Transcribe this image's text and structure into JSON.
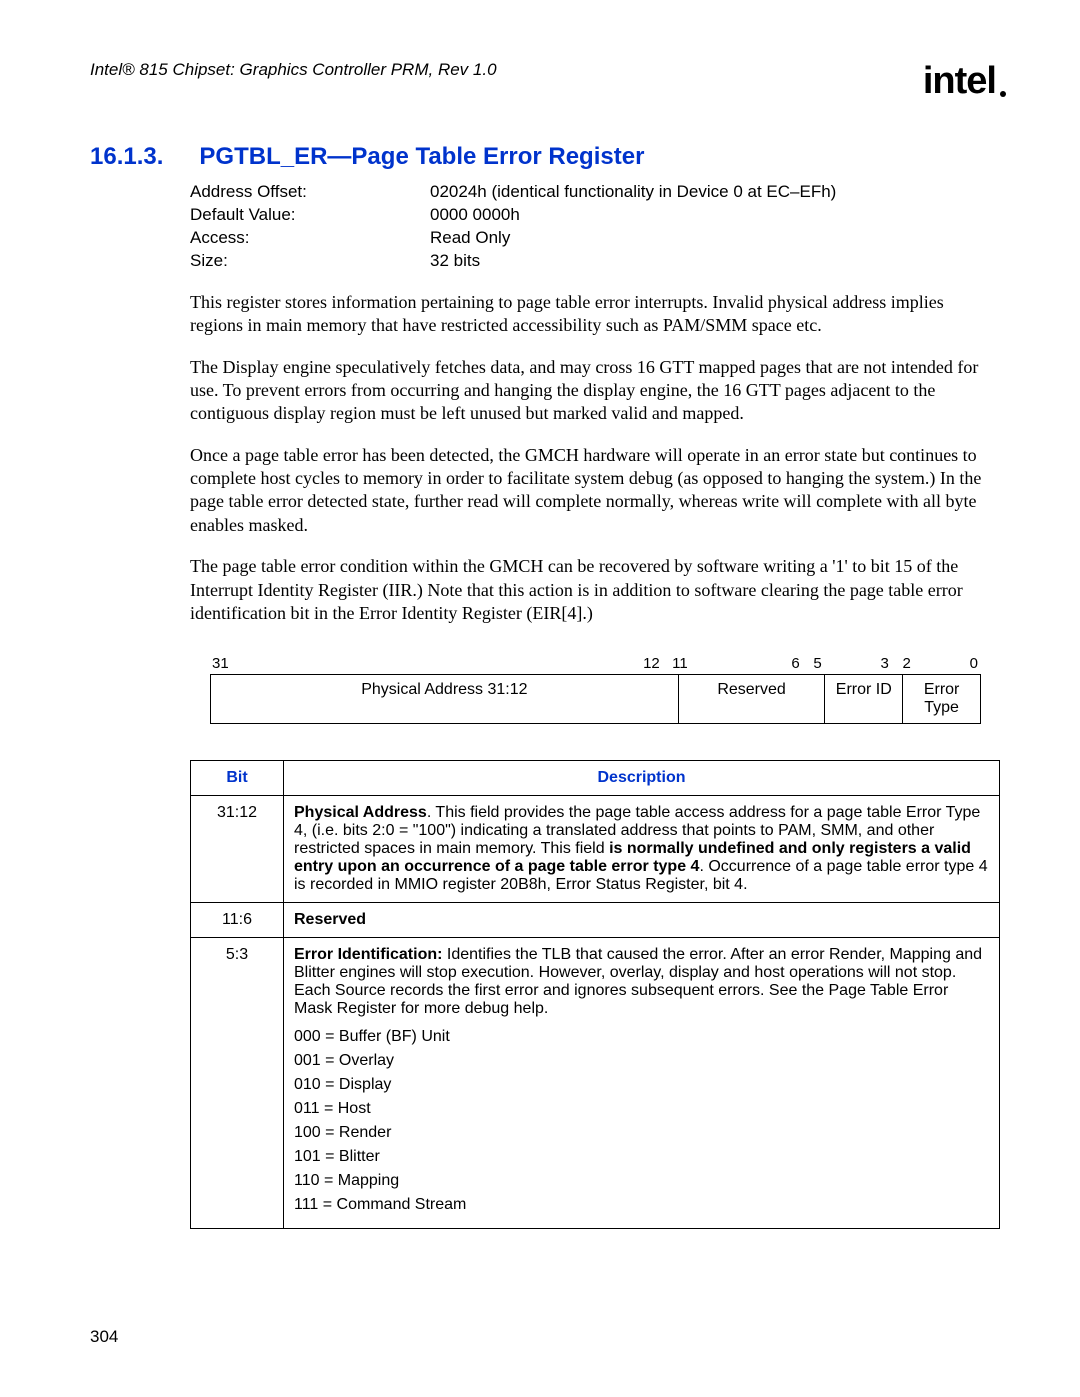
{
  "doc_header": "Intel® 815 Chipset: Graphics Controller PRM, Rev 1.0",
  "logo_text": "intel",
  "section": {
    "number": "16.1.3.",
    "title": "PGTBL_ER—Page Table Error Register"
  },
  "meta": {
    "addr_label": "Address Offset:",
    "addr_value": "02024h (identical functionality in Device 0 at EC–EFh)",
    "default_label": "Default Value:",
    "default_value": "0000 0000h",
    "access_label": "Access:",
    "access_value": "Read Only",
    "size_label": "Size:",
    "size_value": "32 bits"
  },
  "paragraphs": [
    "This register stores information pertaining to page table error interrupts. Invalid physical address implies regions in main memory that have restricted accessibility such as PAM/SMM space etc.",
    "The Display engine speculatively fetches data, and may cross 16 GTT mapped pages that are not intended for use. To prevent errors from occurring and hanging the display engine, the 16 GTT pages adjacent to the contiguous display region must be left unused but marked valid and mapped.",
    "Once a page table error has been detected, the GMCH hardware will operate in an error state but continues to complete host cycles to memory in order to facilitate system debug (as opposed to hanging the system.) In the page table error detected state, further read will complete normally, whereas write will complete with all byte enables masked.",
    "The page table error condition within the GMCH can be recovered by software writing a '1' to bit 15 of the Interrupt Identity Register (IIR.) Note that this action is in addition to software clearing the page table error identification bit in the Error Identity Register (EIR[4].)"
  ],
  "bitfield": {
    "ticks": [
      "31",
      "12",
      "11",
      "6",
      "5",
      "3",
      "2",
      "0"
    ],
    "cells": {
      "phys": "Physical Address 31:12",
      "res": "Reserved",
      "id": "Error ID",
      "type": "Error Type"
    }
  },
  "desc_table": {
    "headers": {
      "bit": "Bit",
      "desc": "Description"
    },
    "rows": [
      {
        "bit": "31:12",
        "lead_bold": "Physical Address",
        "lead_rest": ". This field provides the page table access address for a page table Error Type 4, (i.e. bits 2:0 = \"100\") indicating a translated address that points to PAM, SMM, and other restricted spaces in main memory. This field ",
        "mid_bold": "is normally undefined and only registers a valid entry upon an occurrence of a page table error type 4",
        "tail": ". Occurrence of a page table error type 4 is recorded in MMIO register 20B8h, Error Status Register, bit 4."
      },
      {
        "bit": "11:6",
        "lead_bold": "Reserved",
        "lead_rest": "",
        "mid_bold": "",
        "tail": ""
      },
      {
        "bit": "5:3",
        "lead_bold": "Error Identification:",
        "lead_rest": " Identifies the TLB that caused the error. After an error Render, Mapping and Blitter engines will stop execution. However, overlay, display and host operations will not stop. Each Source records the first error and ignores subsequent errors. See the Page Table Error Mask Register for more debug help.",
        "mid_bold": "",
        "tail": "",
        "codes": [
          "000 = Buffer (BF) Unit",
          "001 = Overlay",
          "010 = Display",
          "011 = Host",
          "100 = Render",
          "101 = Blitter",
          "110 = Mapping",
          "111 = Command Stream"
        ]
      }
    ]
  },
  "page_number": "304"
}
